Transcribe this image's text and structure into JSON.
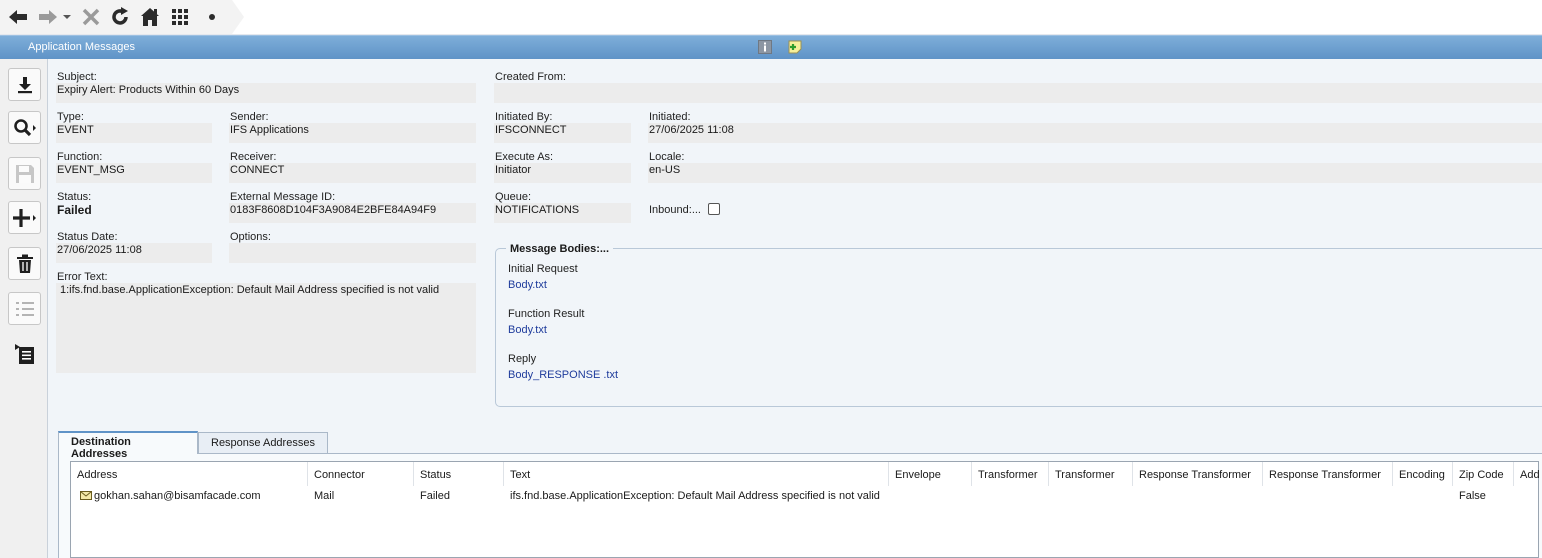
{
  "window": {
    "title": "Application Messages"
  },
  "fields": {
    "subject": {
      "label": "Subject:",
      "value": "Expiry Alert: Products Within 60 Days"
    },
    "created_from": {
      "label": "Created From:",
      "value": ""
    },
    "type": {
      "label": "Type:",
      "value": "EVENT"
    },
    "sender": {
      "label": "Sender:",
      "value": "IFS Applications"
    },
    "initiated_by": {
      "label": "Initiated By:",
      "value": "IFSCONNECT"
    },
    "initiated": {
      "label": "Initiated:",
      "value": "27/06/2025 11:08"
    },
    "function": {
      "label": "Function:",
      "value": "EVENT_MSG"
    },
    "receiver": {
      "label": "Receiver:",
      "value": "CONNECT"
    },
    "execute_as": {
      "label": "Execute As:",
      "value": "Initiator"
    },
    "locale": {
      "label": "Locale:",
      "value": "en-US"
    },
    "status": {
      "label": "Status:",
      "value": "Failed"
    },
    "external_message_id": {
      "label": "External Message ID:",
      "value": "0183F8608D104F3A9084E2BFE84A94F9"
    },
    "queue": {
      "label": "Queue:",
      "value": "NOTIFICATIONS"
    },
    "inbound": {
      "label": "Inbound:...",
      "checked": false
    },
    "status_date": {
      "label": "Status Date:",
      "value": "27/06/2025 11:08"
    },
    "options": {
      "label": "Options:",
      "value": ""
    },
    "error_text": {
      "label": "Error Text:",
      "value": "1:ifs.fnd.base.ApplicationException: Default Mail Address specified is not valid"
    }
  },
  "message_bodies": {
    "title": "Message Bodies:...",
    "items": [
      {
        "label": "Initial Request",
        "link": "Body.txt"
      },
      {
        "label": "Function Result",
        "link": "Body.txt"
      },
      {
        "label": "Reply",
        "link": "Body_RESPONSE .txt"
      }
    ]
  },
  "tabs": [
    {
      "label": "Destination Addresses",
      "active": true
    },
    {
      "label": "Response Addresses",
      "active": false
    }
  ],
  "grid": {
    "columns": [
      "Address",
      "Connector",
      "Status",
      "Text",
      "Envelope",
      "Transformer",
      "Transformer",
      "Response Transformer",
      "Response Transformer",
      "Encoding",
      "Zip Code",
      "Add"
    ],
    "rows": [
      {
        "address": "gokhan.sahan@bisamfacade.com",
        "connector": "Mail",
        "status": "Failed",
        "text": "ifs.fnd.base.ApplicationException: Default Mail Address specified is not valid",
        "envelope": "",
        "transformer1": "",
        "transformer2": "",
        "resp_transformer1": "",
        "resp_transformer2": "",
        "encoding": "",
        "zip_code": "False",
        "add": ""
      }
    ]
  },
  "icons": {
    "nav": [
      "back-arrow-icon",
      "forward-arrow-icon",
      "close-icon",
      "refresh-icon",
      "home-icon",
      "grid-icon",
      "dot-icon"
    ],
    "commands": [
      "download-icon",
      "search-icon",
      "save-icon",
      "add-icon",
      "delete-icon",
      "list-icon",
      "details-icon"
    ],
    "header": [
      "info-icon",
      "note-icon"
    ]
  },
  "colors": {
    "header_bar": "#6fa1d0",
    "link": "#1f3c9c",
    "field_background": "#ececec",
    "content_background": "#f1f5f9"
  }
}
